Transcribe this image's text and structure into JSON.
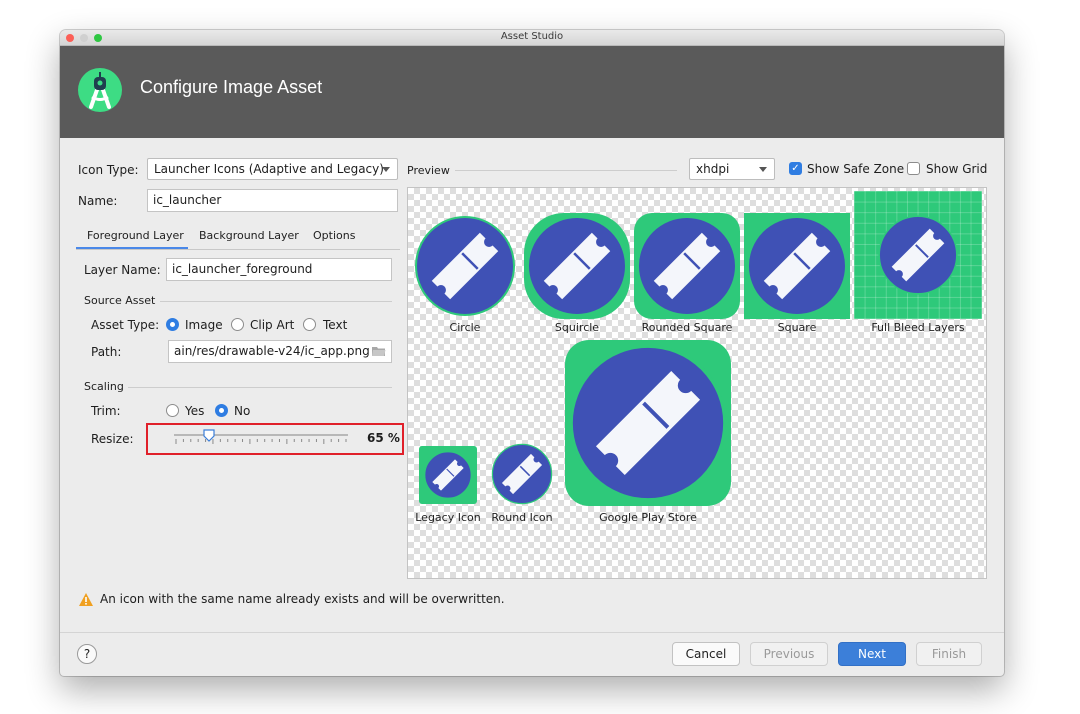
{
  "window": {
    "title": "Asset Studio"
  },
  "header": {
    "title": "Configure Image Asset"
  },
  "icon_type": {
    "label": "Icon Type:",
    "value": "Launcher Icons (Adaptive and Legacy)"
  },
  "name": {
    "label": "Name:",
    "value": "ic_launcher"
  },
  "tabs": [
    {
      "label": "Foreground Layer",
      "selected": true
    },
    {
      "label": "Background Layer",
      "selected": false
    },
    {
      "label": "Options",
      "selected": false
    }
  ],
  "layer_name": {
    "label": "Layer Name:",
    "value": "ic_launcher_foreground"
  },
  "source_asset": {
    "section": "Source Asset",
    "asset_type_label": "Asset Type:",
    "options": [
      "Image",
      "Clip Art",
      "Text"
    ],
    "selected": "Image",
    "path_label": "Path:",
    "path_value": "ain/res/drawable-v24/ic_app.png"
  },
  "scaling": {
    "section": "Scaling",
    "trim_label": "Trim:",
    "trim_options": [
      "Yes",
      "No"
    ],
    "trim_selected": "No",
    "resize_label": "Resize:",
    "resize_value": "65 %",
    "resize_fraction": 0.2
  },
  "preview": {
    "label": "Preview",
    "density": "xhdpi",
    "show_safe_zone": {
      "label": "Show Safe Zone",
      "checked": true
    },
    "show_grid": {
      "label": "Show Grid",
      "checked": false
    },
    "icons": [
      "Circle",
      "Squircle",
      "Rounded Square",
      "Square",
      "Full Bleed Layers",
      "Legacy Icon",
      "Round Icon",
      "Google Play Store"
    ]
  },
  "warning": "An icon with the same name already exists and will be overwritten.",
  "buttons": {
    "help": "?",
    "cancel": "Cancel",
    "previous": "Previous",
    "next": "Next",
    "finish": "Finish"
  },
  "colors": {
    "header_bg": "#5a5a5a",
    "accent": "#3c7fd9",
    "icon_circle": "#3f51b5",
    "icon_bg": "#2ec97a",
    "highlight": "#e0202a",
    "warning": "#f0a020"
  }
}
